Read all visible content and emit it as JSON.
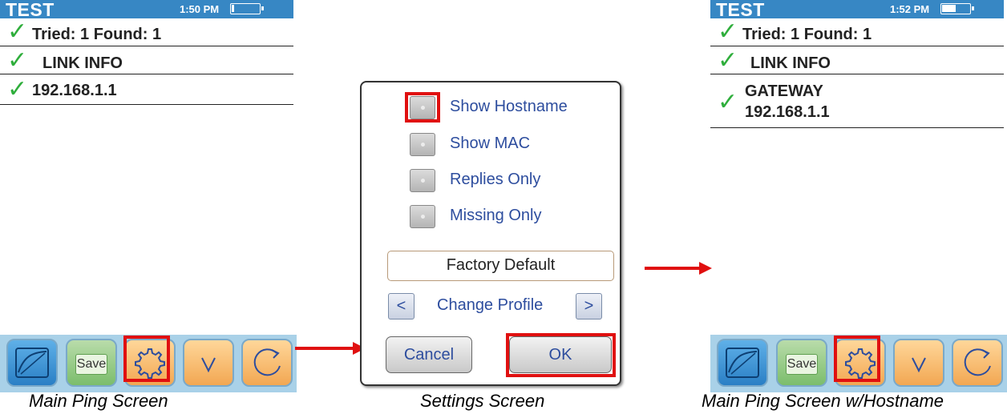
{
  "left_screen": {
    "status": {
      "title": "TEST",
      "time": "1:50 PM",
      "battery_level": 0.1
    },
    "rows": [
      {
        "text": "Tried: 1 Found: 1"
      },
      {
        "text": "LINK INFO"
      },
      {
        "text": "192.168.1.1"
      }
    ],
    "toolbar": {
      "save_label": "Save"
    },
    "caption": "Main Ping Screen"
  },
  "settings_dialog": {
    "options": [
      {
        "label": "Show Hostname"
      },
      {
        "label": "Show MAC"
      },
      {
        "label": "Replies Only"
      },
      {
        "label": "Missing Only"
      }
    ],
    "profile": "Factory Default",
    "prev_label": "<",
    "change_profile_label": "Change Profile",
    "next_label": ">",
    "cancel_label": "Cancel",
    "ok_label": "OK",
    "caption": "Settings Screen"
  },
  "right_screen": {
    "status": {
      "title": "TEST",
      "time": "1:52 PM",
      "battery_level": 0.5
    },
    "rows": [
      {
        "text": "Tried: 1 Found: 1"
      },
      {
        "text": "LINK INFO"
      },
      {
        "text": "GATEWAY",
        "text2": "192.168.1.1"
      }
    ],
    "toolbar": {
      "save_label": "Save"
    },
    "caption": "Main Ping Screen w/Hostname"
  },
  "colors": {
    "status_bar": "#3787c4",
    "check": "#2fae3c",
    "highlight": "#e01010",
    "dialog_text": "#2d4d9e"
  },
  "icons": [
    "graph-icon",
    "save-icon",
    "gear-icon",
    "chevron-down-icon",
    "refresh-icon",
    "checkmark-icon",
    "battery-icon"
  ]
}
